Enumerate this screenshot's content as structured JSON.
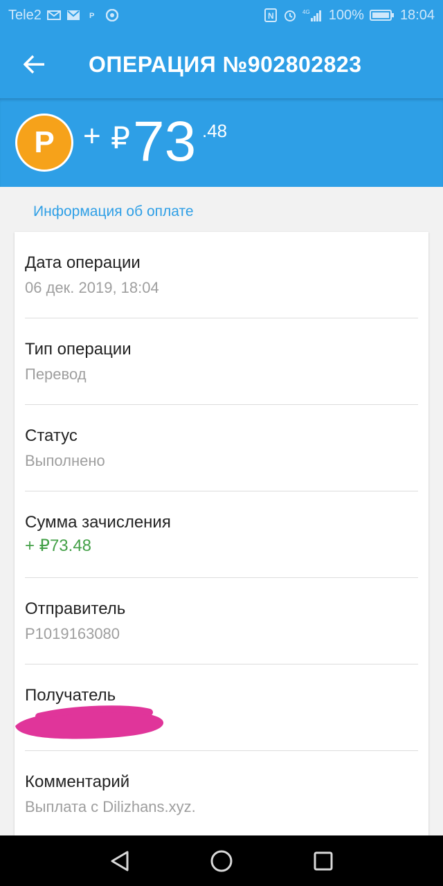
{
  "status_bar": {
    "carrier": "Tele2",
    "network": "4G",
    "battery": "100%",
    "time": "18:04",
    "left_icons": [
      "mail-icon",
      "gmail-icon",
      "payeer-icon",
      "chrome-icon"
    ],
    "right_icons": [
      "nfc-icon",
      "alarm-icon",
      "signal-icon",
      "battery-icon"
    ]
  },
  "app_bar": {
    "title": "ОПЕРАЦИЯ №902802823"
  },
  "amount": {
    "sign": "+",
    "currency": "₽",
    "main": "73",
    "cents": ".48",
    "coin_letter": "Р"
  },
  "section": {
    "title": "Информация об оплате"
  },
  "rows": [
    {
      "label": "Дата операции",
      "value": "06 дек. 2019, 18:04"
    },
    {
      "label": "Тип операции",
      "value": "Перевод"
    },
    {
      "label": "Статус",
      "value": "Выполнено"
    },
    {
      "label": "Сумма зачисления",
      "value": "+ ₽73.48"
    },
    {
      "label": "Отправитель",
      "value": "P1019163080"
    },
    {
      "label": "Получатель",
      "value": ""
    },
    {
      "label": "Комментарий",
      "value": "Выплата с Dilizhans.xyz."
    }
  ],
  "colors": {
    "primary": "#2e9fe6",
    "coin": "#f6a21a",
    "amount_green": "#43a047",
    "redaction": "#e0359a"
  }
}
